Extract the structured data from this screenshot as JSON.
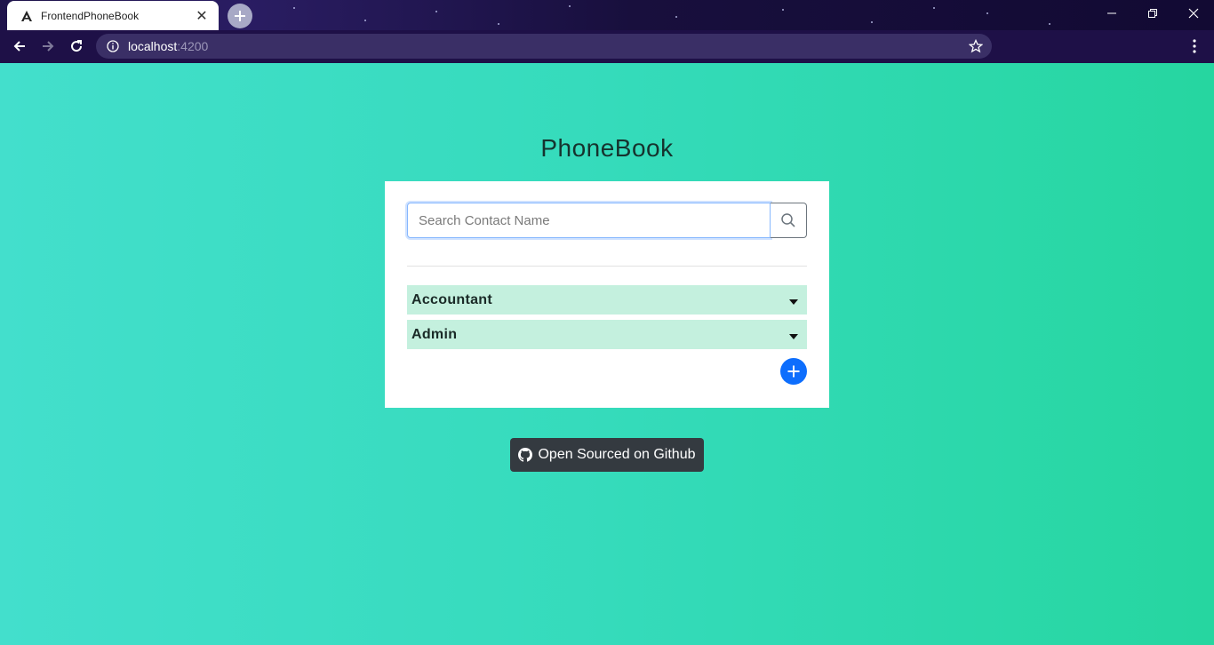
{
  "browser": {
    "tab_title": "FrontendPhoneBook",
    "url_host": "localhost",
    "url_port": ":4200"
  },
  "page": {
    "title": "PhoneBook",
    "search": {
      "placeholder": "Search Contact Name",
      "value": ""
    },
    "groups": [
      {
        "label": "Accountant"
      },
      {
        "label": "Admin"
      }
    ],
    "github_label": "Open Sourced on Github"
  },
  "colors": {
    "accent": "#0d6efd",
    "group_bg": "#c4f0de",
    "page_gradient": [
      "#43dfcc",
      "#26d6a0"
    ],
    "github_button": "#343a40"
  },
  "icons": [
    "angular-icon",
    "search-icon",
    "plus-circle-icon",
    "github-icon",
    "caret-down-icon"
  ]
}
